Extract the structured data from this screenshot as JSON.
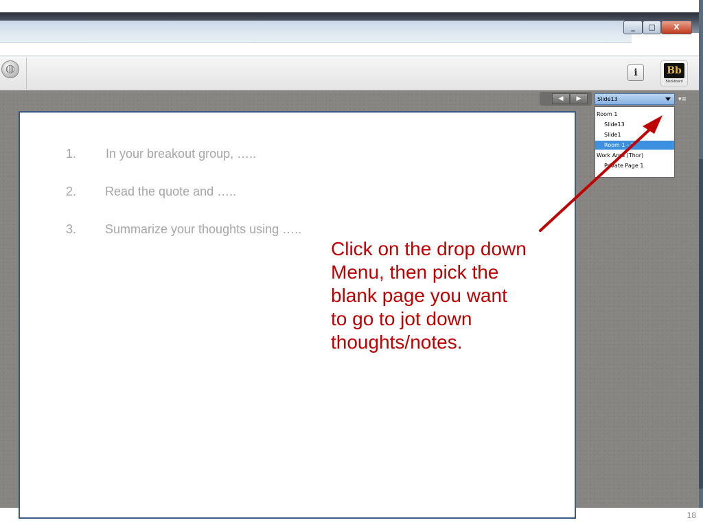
{
  "window": {
    "minimize_glyph": "_",
    "maximize_glyph": "□",
    "close_glyph": "X"
  },
  "toolbar": {
    "info_glyph": "i",
    "logo_mark": "Bb",
    "logo_text": "Blackboard"
  },
  "navigation": {
    "prev_glyph": "◀",
    "next_glyph": "▶",
    "page_selector_value": "Slide13",
    "menu_glyph": "▾≡",
    "dropdown_items": [
      {
        "label": "Room 1",
        "kind": "group",
        "selected": false
      },
      {
        "label": "Slide13",
        "kind": "child",
        "selected": false
      },
      {
        "label": "Slide1",
        "kind": "child",
        "selected": false
      },
      {
        "label": "Room 1 - 1",
        "kind": "child",
        "selected": true
      },
      {
        "label": "Work Area (Thor)",
        "kind": "group",
        "selected": false
      },
      {
        "label": "Private Page 1",
        "kind": "child",
        "selected": false
      }
    ]
  },
  "slide": {
    "steps": [
      {
        "number": "1.",
        "text": " In your breakout group, ….."
      },
      {
        "number": "2.",
        "text": "Read the quote and ….."
      },
      {
        "number": "3.",
        "text": "Summarize your thoughts using ….."
      }
    ],
    "callout_lines": [
      "Click on the drop down",
      "Menu, then pick the",
      "blank page you want",
      "to go to jot down",
      "thoughts/notes."
    ]
  },
  "colors": {
    "callout": "#c00000",
    "arrow": "#c00000",
    "selected_item": "#3d8fe0"
  },
  "page_number": "18"
}
